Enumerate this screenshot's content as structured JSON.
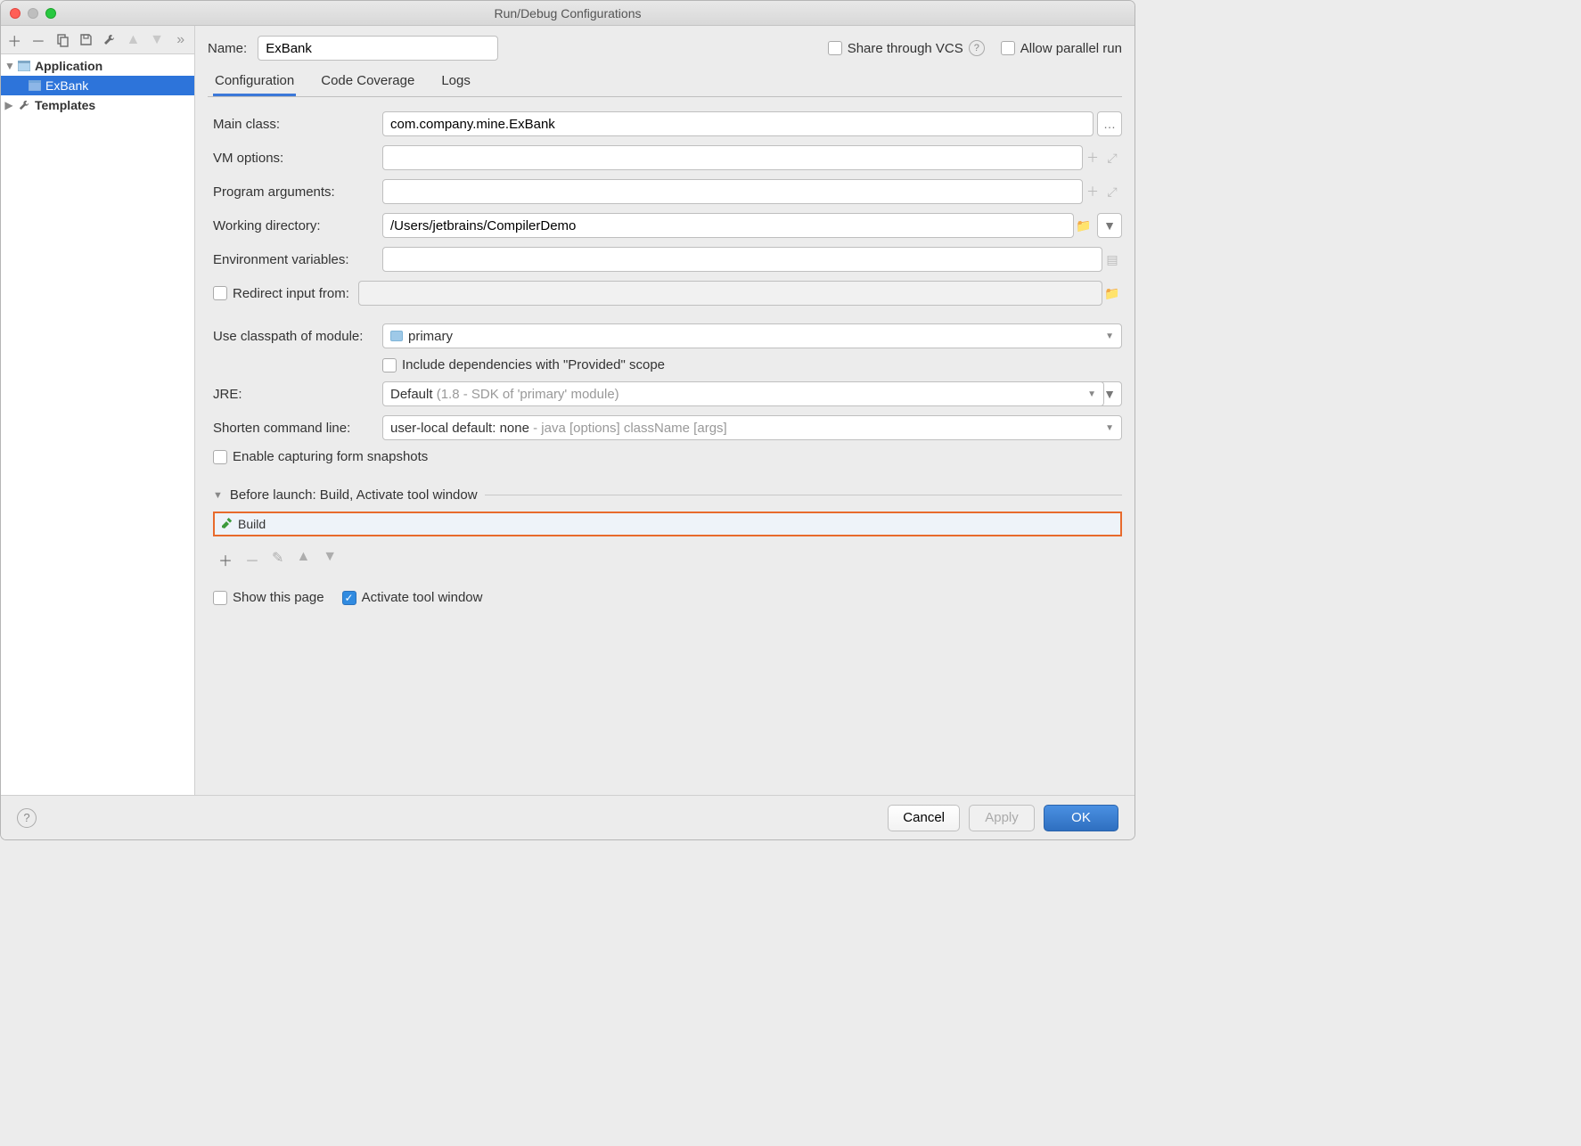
{
  "title": "Run/Debug Configurations",
  "sidebar": {
    "nodes": [
      {
        "label": "Application",
        "bold": true
      },
      {
        "label": "ExBank",
        "selected": true
      },
      {
        "label": "Templates",
        "bold": true
      }
    ]
  },
  "name_label": "Name:",
  "name_value": "ExBank",
  "share_label": "Share through VCS",
  "allow_parallel_label": "Allow parallel run",
  "tabs": [
    "Configuration",
    "Code Coverage",
    "Logs"
  ],
  "form": {
    "main_class_label": "Main class:",
    "main_class_value": "com.company.mine.ExBank",
    "vm_options_label": "VM options:",
    "program_args_label": "Program arguments:",
    "workdir_label": "Working directory:",
    "workdir_value": "/Users/jetbrains/CompilerDemo",
    "env_label": "Environment variables:",
    "redirect_label": "Redirect input from:",
    "classpath_label": "Use classpath of module:",
    "classpath_value": "primary",
    "include_deps_label": "Include dependencies with \"Provided\" scope",
    "jre_label": "JRE:",
    "jre_value": "Default",
    "jre_hint": "(1.8 - SDK of 'primary' module)",
    "shorten_label": "Shorten command line:",
    "shorten_value": "user-local default: none",
    "shorten_hint": "- java [options] className [args]",
    "enable_capture_label": "Enable capturing form snapshots"
  },
  "before_launch": {
    "header": "Before launch: Build, Activate tool window",
    "item": "Build",
    "show_page_label": "Show this page",
    "activate_label": "Activate tool window"
  },
  "footer": {
    "cancel": "Cancel",
    "apply": "Apply",
    "ok": "OK"
  }
}
